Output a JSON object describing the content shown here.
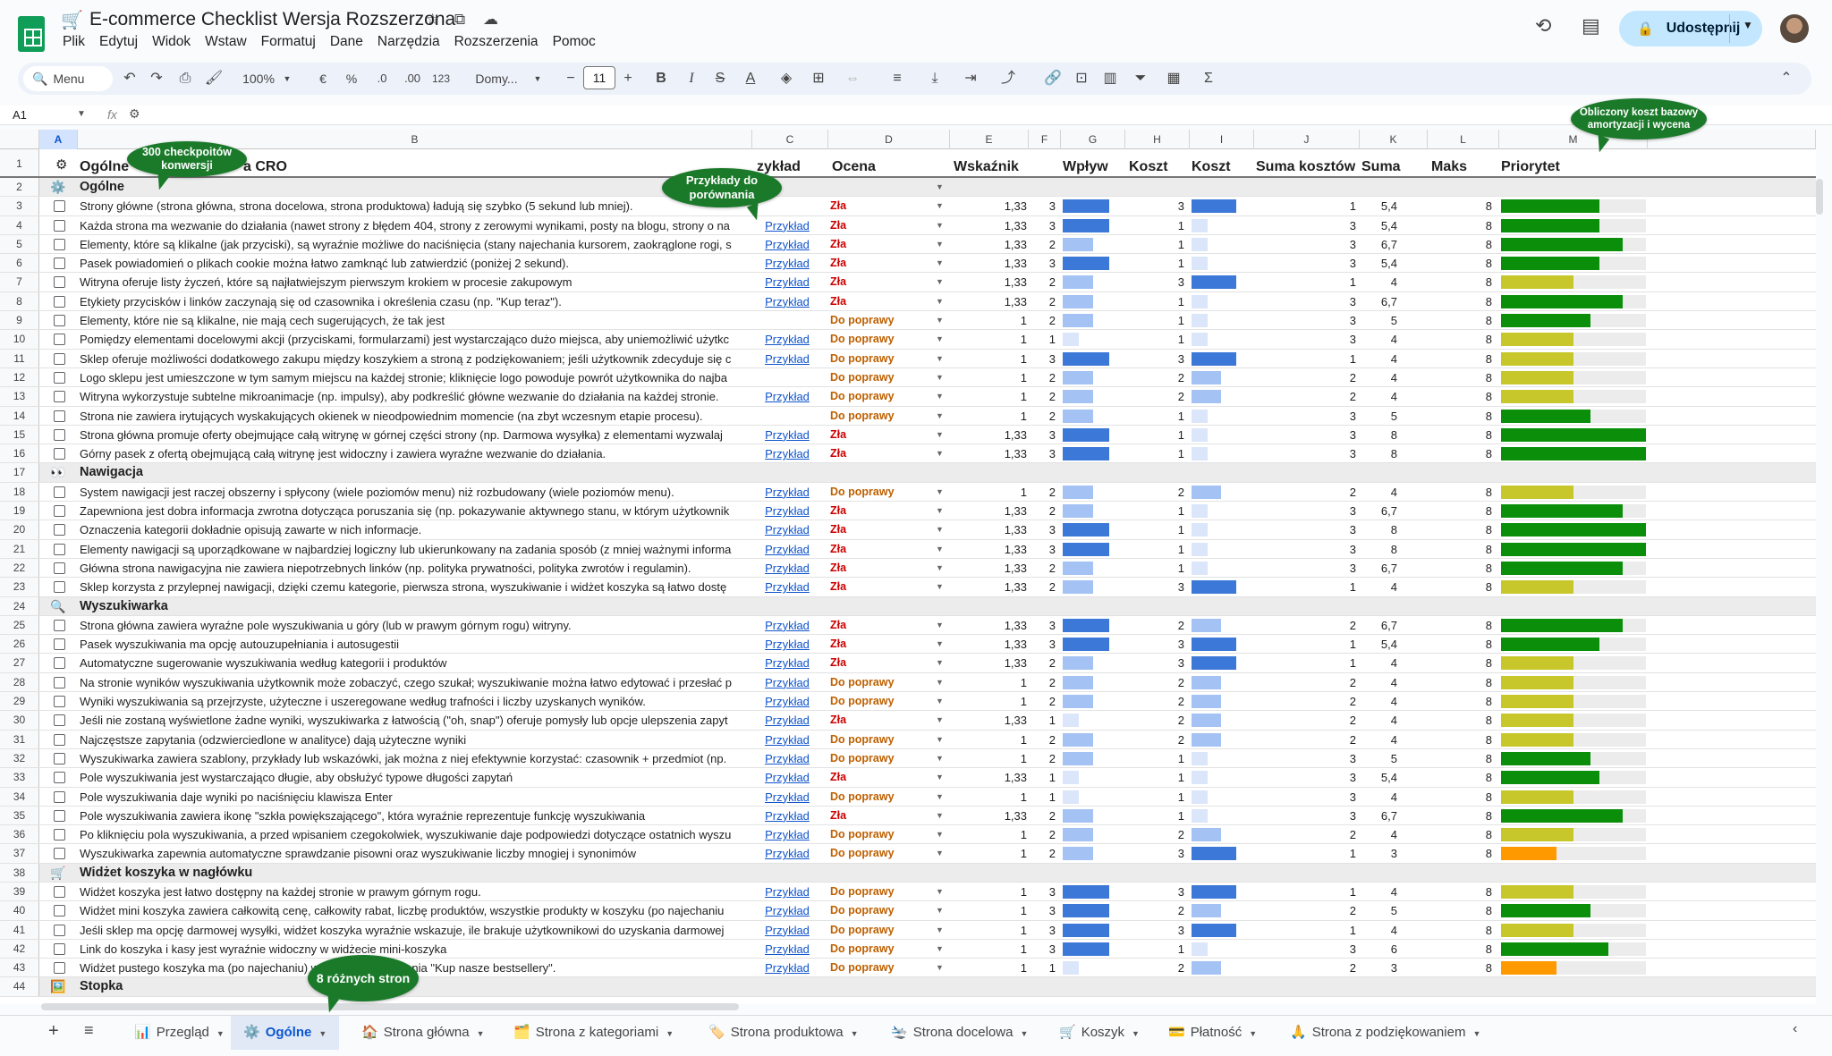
{
  "doc": {
    "title": "E-commerce Checklist Wersja Rozszerzona",
    "title_emoji": "🛒"
  },
  "menu": [
    "Plik",
    "Edytuj",
    "Widok",
    "Wstaw",
    "Formatuj",
    "Dane",
    "Narzędzia",
    "Rozszerzenia",
    "Pomoc"
  ],
  "share_label": "Udostępnij",
  "toolbar": {
    "search": "Menu",
    "zoom": "100%",
    "currency": "€",
    "percent": "%",
    "dec_less": ".0",
    "dec_more": ".00",
    "num_fmt": "123",
    "font": "Domy...",
    "font_size": "11"
  },
  "namebox": "A1",
  "fx": "fx",
  "columns": [
    "A",
    "B",
    "C",
    "D",
    "E",
    "F",
    "G",
    "H",
    "I",
    "J",
    "K",
    "L",
    "M"
  ],
  "header_row": {
    "b": "Ogólne",
    "b_tail": "a CRO",
    "c": "zykład",
    "d": "Ocena",
    "e": "Wskaźnik",
    "g": "Wpływ",
    "h": "Koszt",
    "i": "Koszt",
    "j": "Suma kosztów",
    "k": "Suma",
    "l": "Maks",
    "m": "Priorytet"
  },
  "link_label": "Przykład",
  "ratings": {
    "zla": "Zła",
    "dop": "Do poprawy"
  },
  "colors": {
    "bar_blue_dark": "#3c78d8",
    "bar_blue_mid": "#a4c2f4",
    "bar_blue_light": "#dbe6fb",
    "prio_green": "#0b8f0b",
    "prio_yellow": "#c7c72b",
    "prio_orange": "#ff9900"
  },
  "bubbles": {
    "b1": "300 checkpoitów konwersji",
    "b2": "Przykłady do porównania",
    "b3": "Obliczony koszt bazowy amortyzacji i wycena",
    "b4": "8 różnych stron"
  },
  "rows": [
    {
      "n": 2,
      "type": "section",
      "icon": "⚙️",
      "title": "Ogólne"
    },
    {
      "n": 3,
      "text": "Strony główne (strona główna, strona docelowa, strona produktowa) ładują się szybko (5 sekund lub mniej).",
      "link": false,
      "rating": "zla",
      "e": "1,33",
      "f": "3",
      "h": "3",
      "j": "1",
      "k": "5,4",
      "l": "8",
      "prio": 0.68,
      "pc": "g"
    },
    {
      "n": 4,
      "text": "Każda strona ma wezwanie do działania (nawet strony z błędem 404, strony z zerowymi wynikami, posty na blogu, strony o na",
      "link": true,
      "rating": "zla",
      "e": "1,33",
      "f": "3",
      "h": "1",
      "j": "3",
      "k": "5,4",
      "l": "8",
      "prio": 0.68,
      "pc": "g"
    },
    {
      "n": 5,
      "text": "Elementy, które są klikalne (jak przyciski), są wyraźnie możliwe do naciśnięcia (stany najechania kursorem, zaokrąglone rogi, s",
      "link": true,
      "rating": "zla",
      "e": "1,33",
      "f": "2",
      "h": "1",
      "j": "3",
      "k": "6,7",
      "l": "8",
      "prio": 0.84,
      "pc": "g"
    },
    {
      "n": 6,
      "text": "Pasek powiadomień o plikach cookie można łatwo zamknąć lub zatwierdzić (poniżej 2 sekund).",
      "link": true,
      "rating": "zla",
      "e": "1,33",
      "f": "3",
      "h": "1",
      "j": "3",
      "k": "5,4",
      "l": "8",
      "prio": 0.68,
      "pc": "g"
    },
    {
      "n": 7,
      "text": "Witryna oferuje listy życzeń, które są najłatwiejszym pierwszym krokiem w procesie zakupowym",
      "link": true,
      "rating": "zla",
      "e": "1,33",
      "f": "2",
      "h": "3",
      "j": "1",
      "k": "4",
      "l": "8",
      "prio": 0.5,
      "pc": "y"
    },
    {
      "n": 8,
      "text": "Etykiety przycisków i linków zaczynają się od czasownika i określenia czasu (np. \"Kup teraz\").",
      "link": true,
      "rating": "zla",
      "e": "1,33",
      "f": "2",
      "h": "1",
      "j": "3",
      "k": "6,7",
      "l": "8",
      "prio": 0.84,
      "pc": "g"
    },
    {
      "n": 9,
      "text": "Elementy, które nie są klikalne, nie mają cech sugerujących, że tak jest",
      "link": false,
      "rating": "dop",
      "e": "1",
      "f": "2",
      "h": "1",
      "j": "3",
      "k": "5",
      "l": "8",
      "prio": 0.62,
      "pc": "g"
    },
    {
      "n": 10,
      "text": "Pomiędzy elementami docelowymi akcji (przyciskami, formularzami) jest wystarczająco dużo miejsca, aby uniemożliwić użytkc",
      "link": true,
      "rating": "dop",
      "e": "1",
      "f": "1",
      "h": "1",
      "j": "3",
      "k": "4",
      "l": "8",
      "prio": 0.5,
      "pc": "y"
    },
    {
      "n": 11,
      "text": "Sklep oferuje możliwości dodatkowego zakupu między koszykiem a stroną z podziękowaniem; jeśli użytkownik zdecyduje się c",
      "link": true,
      "rating": "dop",
      "e": "1",
      "f": "3",
      "h": "3",
      "j": "1",
      "k": "4",
      "l": "8",
      "prio": 0.5,
      "pc": "y"
    },
    {
      "n": 12,
      "text": "Logo sklepu jest umieszczone w tym samym miejscu na każdej stronie; kliknięcie logo powoduje powrót użytkownika do najba",
      "link": false,
      "rating": "dop",
      "e": "1",
      "f": "2",
      "h": "2",
      "j": "2",
      "k": "4",
      "l": "8",
      "prio": 0.5,
      "pc": "y"
    },
    {
      "n": 13,
      "text": "Witryna wykorzystuje subtelne mikroanimacje (np. impulsy), aby podkreślić główne wezwanie do działania na każdej stronie.",
      "link": true,
      "rating": "dop",
      "e": "1",
      "f": "2",
      "h": "2",
      "j": "2",
      "k": "4",
      "l": "8",
      "prio": 0.5,
      "pc": "y"
    },
    {
      "n": 14,
      "text": "Strona nie zawiera irytujących wyskakujących okienek w nieodpowiednim momencie (na zbyt wczesnym etapie procesu).",
      "link": false,
      "rating": "dop",
      "e": "1",
      "f": "2",
      "h": "1",
      "j": "3",
      "k": "5",
      "l": "8",
      "prio": 0.62,
      "pc": "g"
    },
    {
      "n": 15,
      "text": "Strona główna promuje oferty obejmujące całą witrynę w górnej części strony (np. Darmowa wysyłka) z elementami wyzwalaj",
      "link": true,
      "rating": "zla",
      "e": "1,33",
      "f": "3",
      "h": "1",
      "j": "3",
      "k": "8",
      "l": "8",
      "prio": 1,
      "pc": "g"
    },
    {
      "n": 16,
      "text": "Górny pasek z ofertą obejmującą całą witrynę jest widoczny i zawiera wyraźne wezwanie do działania.",
      "link": true,
      "rating": "zla",
      "e": "1,33",
      "f": "3",
      "h": "1",
      "j": "3",
      "k": "8",
      "l": "8",
      "prio": 1,
      "pc": "g"
    },
    {
      "n": 17,
      "type": "section",
      "icon": "👀",
      "title": "Nawigacja"
    },
    {
      "n": 18,
      "text": "System nawigacji jest raczej obszerny i spłycony (wiele poziomów menu) niż rozbudowany (wiele poziomów menu).",
      "link": true,
      "rating": "dop",
      "e": "1",
      "f": "2",
      "h": "2",
      "j": "2",
      "k": "4",
      "l": "8",
      "prio": 0.5,
      "pc": "y"
    },
    {
      "n": 19,
      "text": "Zapewniona jest dobra informacja zwrotna dotycząca poruszania się (np. pokazywanie aktywnego stanu, w którym użytkownik",
      "link": true,
      "rating": "zla",
      "e": "1,33",
      "f": "2",
      "h": "1",
      "j": "3",
      "k": "6,7",
      "l": "8",
      "prio": 0.84,
      "pc": "g"
    },
    {
      "n": 20,
      "text": "Oznaczenia kategorii dokładnie opisują zawarte w nich informacje.",
      "link": true,
      "rating": "zla",
      "e": "1,33",
      "f": "3",
      "h": "1",
      "j": "3",
      "k": "8",
      "l": "8",
      "prio": 1,
      "pc": "g"
    },
    {
      "n": 21,
      "text": "Elementy nawigacji są uporządkowane w najbardziej logiczny lub ukierunkowany na zadania sposób (z mniej ważnymi informa",
      "link": true,
      "rating": "zla",
      "e": "1,33",
      "f": "3",
      "h": "1",
      "j": "3",
      "k": "8",
      "l": "8",
      "prio": 1,
      "pc": "g"
    },
    {
      "n": 22,
      "text": "Główna strona nawigacyjna nie zawiera niepotrzebnych linków (np. polityka prywatności, polityka zwrotów i regulamin).",
      "link": true,
      "rating": "zla",
      "e": "1,33",
      "f": "2",
      "h": "1",
      "j": "3",
      "k": "6,7",
      "l": "8",
      "prio": 0.84,
      "pc": "g"
    },
    {
      "n": 23,
      "text": "Sklep korzysta z przylepnej nawigacji, dzięki czemu kategorie, pierwsza strona, wyszukiwanie i widżet koszyka są łatwo dostę",
      "link": true,
      "rating": "zla",
      "e": "1,33",
      "f": "2",
      "h": "3",
      "j": "1",
      "k": "4",
      "l": "8",
      "prio": 0.5,
      "pc": "y"
    },
    {
      "n": 24,
      "type": "section",
      "icon": "🔍",
      "title": "Wyszukiwarka"
    },
    {
      "n": 25,
      "text": "Strona główna zawiera wyraźne pole wyszukiwania u góry (lub w prawym górnym rogu) witryny.",
      "link": true,
      "rating": "zla",
      "e": "1,33",
      "f": "3",
      "h": "2",
      "j": "2",
      "k": "6,7",
      "l": "8",
      "prio": 0.84,
      "pc": "g"
    },
    {
      "n": 26,
      "text": "Pasek wyszukiwania ma opcję autouzupełniania i autosugestii",
      "link": true,
      "rating": "zla",
      "e": "1,33",
      "f": "3",
      "h": "3",
      "j": "1",
      "k": "5,4",
      "l": "8",
      "prio": 0.68,
      "pc": "g"
    },
    {
      "n": 27,
      "text": "Automatyczne sugerowanie wyszukiwania według kategorii i produktów",
      "link": true,
      "rating": "zla",
      "e": "1,33",
      "f": "2",
      "h": "3",
      "j": "1",
      "k": "4",
      "l": "8",
      "prio": 0.5,
      "pc": "y"
    },
    {
      "n": 28,
      "text": "Na stronie wyników wyszukiwania użytkownik może zobaczyć, czego szukał; wyszukiwanie można łatwo edytować i przesłać p",
      "link": true,
      "rating": "dop",
      "e": "1",
      "f": "2",
      "h": "2",
      "j": "2",
      "k": "4",
      "l": "8",
      "prio": 0.5,
      "pc": "y"
    },
    {
      "n": 29,
      "text": "Wyniki wyszukiwania są przejrzyste, użyteczne i uszeregowane według trafności i liczby uzyskanych wyników.",
      "link": true,
      "rating": "dop",
      "e": "1",
      "f": "2",
      "h": "2",
      "j": "2",
      "k": "4",
      "l": "8",
      "prio": 0.5,
      "pc": "y"
    },
    {
      "n": 30,
      "text": "Jeśli nie zostaną wyświetlone żadne wyniki, wyszukiwarka z łatwością (\"oh, snap\") oferuje pomysły lub opcje ulepszenia zapyt",
      "link": true,
      "rating": "zla",
      "e": "1,33",
      "f": "1",
      "h": "2",
      "j": "2",
      "k": "4",
      "l": "8",
      "prio": 0.5,
      "pc": "y"
    },
    {
      "n": 31,
      "text": "Najczęstsze zapytania (odzwierciedlone w analityce) dają użyteczne wyniki",
      "link": true,
      "rating": "dop",
      "e": "1",
      "f": "2",
      "h": "2",
      "j": "2",
      "k": "4",
      "l": "8",
      "prio": 0.5,
      "pc": "y"
    },
    {
      "n": 32,
      "text": "Wyszukiwarka zawiera szablony, przykłady lub wskazówki, jak można z niej efektywnie korzystać: czasownik + przedmiot (np.",
      "link": true,
      "rating": "dop",
      "e": "1",
      "f": "2",
      "h": "1",
      "j": "3",
      "k": "5",
      "l": "8",
      "prio": 0.62,
      "pc": "g"
    },
    {
      "n": 33,
      "text": "Pole wyszukiwania jest wystarczająco długie, aby obsłużyć typowe długości zapytań",
      "link": true,
      "rating": "zla",
      "e": "1,33",
      "f": "1",
      "h": "1",
      "j": "3",
      "k": "5,4",
      "l": "8",
      "prio": 0.68,
      "pc": "g"
    },
    {
      "n": 34,
      "text": "Pole wyszukiwania daje wyniki po naciśnięciu klawisza Enter",
      "link": true,
      "rating": "dop",
      "e": "1",
      "f": "1",
      "h": "1",
      "j": "3",
      "k": "4",
      "l": "8",
      "prio": 0.5,
      "pc": "y"
    },
    {
      "n": 35,
      "text": "Pole wyszukiwania zawiera ikonę \"szkła powiększającego\", która wyraźnie reprezentuje funkcję wyszukiwania",
      "link": true,
      "rating": "zla",
      "e": "1,33",
      "f": "2",
      "h": "1",
      "j": "3",
      "k": "6,7",
      "l": "8",
      "prio": 0.84,
      "pc": "g"
    },
    {
      "n": 36,
      "text": "Po kliknięciu pola wyszukiwania, a przed wpisaniem czegokolwiek, wyszukiwanie daje podpowiedzi dotyczące ostatnich wyszu",
      "link": true,
      "rating": "dop",
      "e": "1",
      "f": "2",
      "h": "2",
      "j": "2",
      "k": "4",
      "l": "8",
      "prio": 0.5,
      "pc": "y"
    },
    {
      "n": 37,
      "text": "Wyszukiwarka zapewnia automatyczne sprawdzanie pisowni oraz wyszukiwanie liczby mnogiej i synonimów",
      "link": true,
      "rating": "dop",
      "e": "1",
      "f": "2",
      "h": "3",
      "j": "1",
      "k": "3",
      "l": "8",
      "prio": 0.38,
      "pc": "o"
    },
    {
      "n": 38,
      "type": "section",
      "icon": "🛒",
      "title": "Widżet koszyka w nagłówku"
    },
    {
      "n": 39,
      "text": "Widżet koszyka jest łatwo dostępny na każdej stronie w prawym górnym rogu.",
      "link": true,
      "rating": "dop",
      "e": "1",
      "f": "3",
      "h": "3",
      "j": "1",
      "k": "4",
      "l": "8",
      "prio": 0.5,
      "pc": "y"
    },
    {
      "n": 40,
      "text": "Widżet mini koszyka zawiera całkowitą cenę, całkowity rabat, liczbę produktów, wszystkie produkty w koszyku (po najechaniu",
      "link": true,
      "rating": "dop",
      "e": "1",
      "f": "3",
      "h": "2",
      "j": "2",
      "k": "5",
      "l": "8",
      "prio": 0.62,
      "pc": "g"
    },
    {
      "n": 41,
      "text": "Jeśli sklep ma opcję darmowej wysyłki, widżet koszyka wyraźnie wskazuje, ile brakuje użytkownikowi do uzyskania darmowej",
      "link": true,
      "rating": "dop",
      "e": "1",
      "f": "3",
      "h": "3",
      "j": "1",
      "k": "4",
      "l": "8",
      "prio": 0.5,
      "pc": "y"
    },
    {
      "n": 42,
      "text": "Link do koszyka i kasy jest wyraźnie widoczny w widżecie mini-koszyka",
      "link": true,
      "rating": "dop",
      "e": "1",
      "f": "3",
      "h": "1",
      "j": "3",
      "k": "6",
      "l": "8",
      "prio": 0.74,
      "pc": "g"
    },
    {
      "n": 43,
      "text": "Widżet pustego koszyka ma (po najechaniu) wezwanie do działania \"Kup nasze bestsellery\".",
      "link": true,
      "rating": "dop",
      "e": "1",
      "f": "1",
      "h": "2",
      "j": "2",
      "k": "3",
      "l": "8",
      "prio": 0.38,
      "pc": "o"
    },
    {
      "n": 44,
      "type": "section",
      "icon": "🖼️",
      "title": "Stopka"
    }
  ],
  "tabs": [
    {
      "icon": "📊",
      "label": "Przegląd"
    },
    {
      "icon": "⚙️",
      "label": "Ogólne",
      "active": true
    },
    {
      "icon": "🏠",
      "label": "Strona główna"
    },
    {
      "icon": "🗂️",
      "label": "Strona z kategoriami"
    },
    {
      "icon": "🏷️",
      "label": "Strona produktowa"
    },
    {
      "icon": "🛬",
      "label": "Strona docelowa"
    },
    {
      "icon": "🛒",
      "label": "Koszyk"
    },
    {
      "icon": "💳",
      "label": "Płatność"
    },
    {
      "icon": "🙏",
      "label": "Strona z podziękowaniem"
    }
  ]
}
